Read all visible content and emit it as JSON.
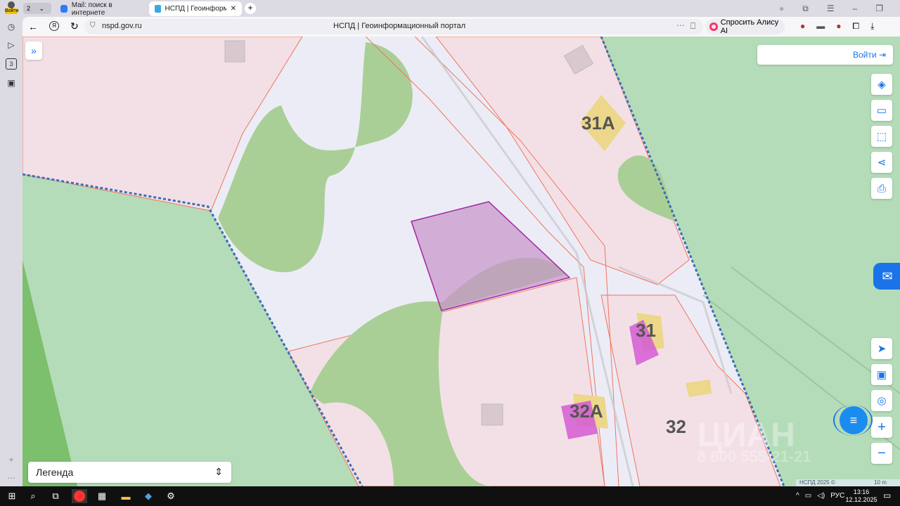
{
  "browser": {
    "profile_label": "Войти",
    "tab_count": "2",
    "tabs": [
      {
        "title": "Mail: поиск в интернете"
      },
      {
        "title": "НСПД | Геоинформаци"
      }
    ],
    "url": "nspd.gov.ru",
    "page_title": "НСПД | Геоинформационный портал",
    "alice_button": "Спросить Алису AI",
    "sidebar_badge": "3"
  },
  "map": {
    "login_button": "Войти",
    "legend_label": "Легенда",
    "labels": [
      "31А",
      "31",
      "32А",
      "32"
    ],
    "watermark": "ЦИАН",
    "watermark_number": "8 800 555-21-21",
    "attribution": "НСПД 2025 ©",
    "scale": "10 m",
    "colors": {
      "parcel_fill": "#f3e0e6",
      "parcel_stroke": "#f0745c",
      "forest": "#a9cf96",
      "green_zone": "#b4dcb8",
      "selected": "#c793c9",
      "boundary": "#3d6fb4"
    }
  },
  "taskbar": {
    "lang": "РУС",
    "time": "13:16",
    "date": "12.12.2025"
  }
}
